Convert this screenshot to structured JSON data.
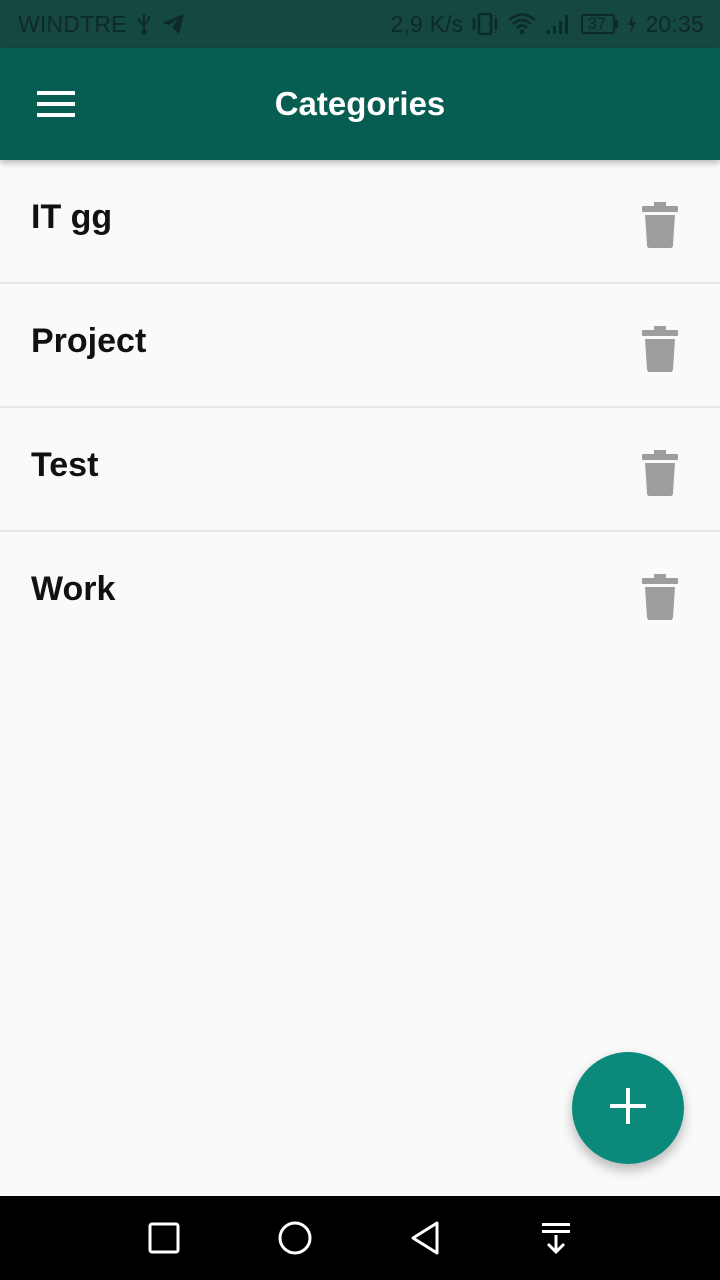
{
  "status_bar": {
    "carrier": "WINDTRE",
    "net_speed": "2,9 K/s",
    "battery_level": "37",
    "time": "20:35",
    "icons": [
      "usb-icon",
      "telegram-icon",
      "vibrate-icon",
      "wifi-icon",
      "signal-icon",
      "battery-icon",
      "charging-icon"
    ]
  },
  "app_bar": {
    "title": "Categories",
    "menu_icon": "hamburger-menu-icon"
  },
  "categories": [
    {
      "label": "IT gg",
      "action_icon": "trash-icon"
    },
    {
      "label": "Project",
      "action_icon": "trash-icon"
    },
    {
      "label": "Test",
      "action_icon": "trash-icon"
    },
    {
      "label": "Work",
      "action_icon": "trash-icon"
    }
  ],
  "fab": {
    "icon": "plus-icon"
  },
  "nav_bar": {
    "icons": [
      "recents-square-icon",
      "home-circle-icon",
      "back-triangle-icon",
      "notification-pull-icon"
    ]
  },
  "colors": {
    "app_bar": "#085d53",
    "status_bar": "#154840",
    "fab": "#0b8a7b",
    "background": "#fafafa",
    "trash_icon": "#9e9e9e"
  }
}
